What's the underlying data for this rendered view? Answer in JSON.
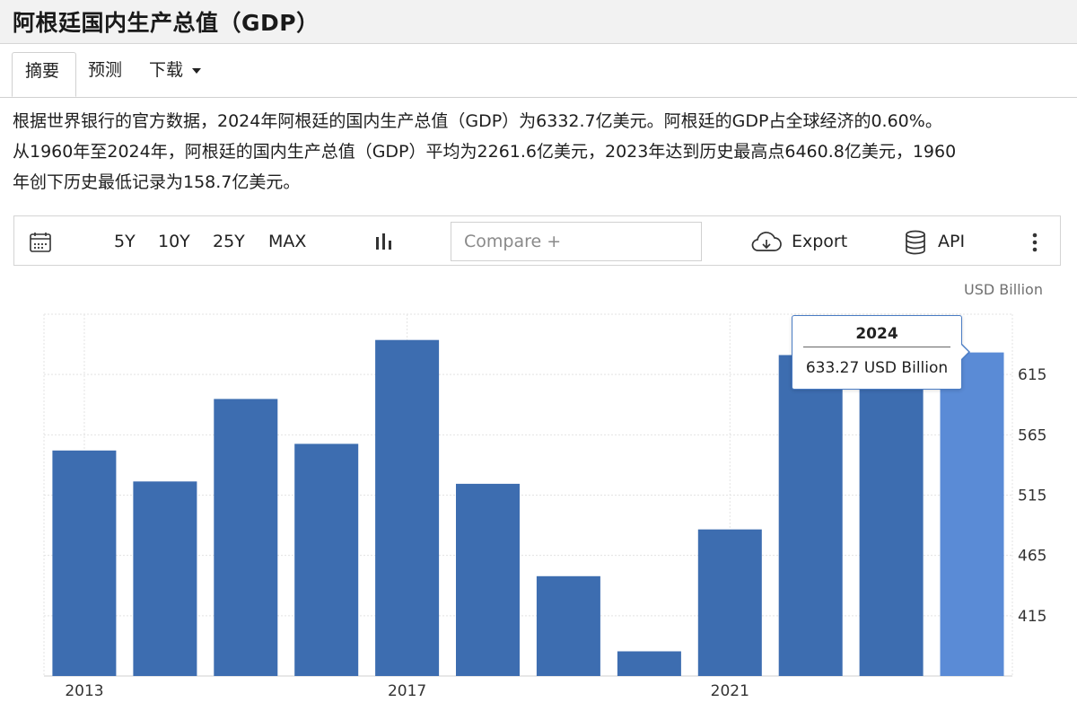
{
  "page": {
    "title": "阿根廷国内生产总值（GDP）"
  },
  "tabs": [
    {
      "label": "摘要",
      "active": true
    },
    {
      "label": "预测",
      "active": false
    },
    {
      "label": "下载",
      "active": false,
      "dropdown": true
    }
  ],
  "summary": {
    "line1": "根据世界银行的官方数据，2024年阿根廷的国内生产总值（GDP）为6332.7亿美元。阿根廷的GDP占全球经济的0.60%。",
    "line2": "从1960年至2024年，阿根廷的国内生产总值（GDP）平均为2261.6亿美元，2023年达到历史最高点6460.8亿美元，1960",
    "line3": "年创下历史最低记录为158.7亿美元。"
  },
  "toolbar": {
    "calendar_icon": "calendar-icon",
    "ranges": [
      "5Y",
      "10Y",
      "25Y",
      "MAX"
    ],
    "chart_type_icon": "bar-chart-icon",
    "compare_placeholder": "Compare +",
    "export_label": "Export",
    "export_icon": "cloud-download-icon",
    "api_label": "API",
    "api_icon": "database-icon",
    "more_icon": "more-vertical-icon"
  },
  "chart_data": {
    "type": "bar",
    "unit_label": "USD Billion",
    "x": [
      2013,
      2014,
      2015,
      2016,
      2017,
      2018,
      2019,
      2020,
      2021,
      2022,
      2023,
      2024
    ],
    "values": [
      552.0,
      526.3,
      594.7,
      557.5,
      643.6,
      524.4,
      447.8,
      385.5,
      486.6,
      631.1,
      646.08,
      633.27
    ],
    "x_tick_labels": [
      "2013",
      "2017",
      "2021"
    ],
    "y_ticks": [
      415,
      465,
      515,
      565,
      615
    ],
    "ylim": [
      365,
      665
    ],
    "highlight_index": 11,
    "colors": {
      "bar": "#3d6db0",
      "highlight": "#5a8bd6"
    },
    "grid": true,
    "y_axis_side": "right",
    "tooltip": {
      "year": "2024",
      "value_text": "633.27 USD Billion"
    }
  }
}
